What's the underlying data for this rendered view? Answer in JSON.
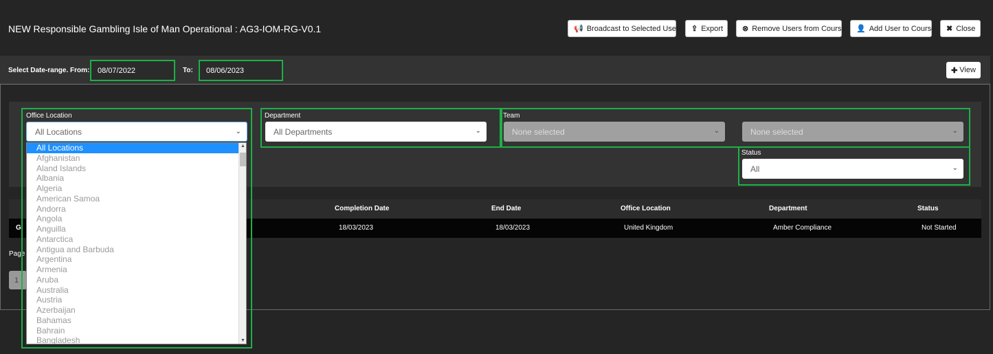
{
  "header": {
    "title": "NEW Responsible Gambling Isle of Man Operational : AG3-IOM-RG-V0.1",
    "buttons": {
      "broadcast": "Broadcast to Selected Users",
      "export": "Export",
      "remove": "Remove Users from Course",
      "add": "Add User to Course",
      "close": "Close"
    }
  },
  "daterange": {
    "from_label": "Select Date-range. From:",
    "from_value": "08/07/2022",
    "to_label": "To:",
    "to_value": "08/06/2023",
    "view_label": "View"
  },
  "filters": {
    "office_label": "Office Location",
    "office_value": "All Locations",
    "department_label": "Department",
    "department_value": "All Departments",
    "team_label": "Team",
    "team_value": "None selected",
    "team2_value": "None selected",
    "status_label": "Status",
    "status_value": "All"
  },
  "table": {
    "headers": [
      "Completion Date",
      "End Date",
      "Office Location",
      "Department",
      "Status"
    ],
    "row": {
      "first": "G",
      "completion_date": "18/03/2023",
      "end_date": "18/03/2023",
      "office": "United Kingdom",
      "department": "Amber Compliance",
      "status": "Not Started"
    }
  },
  "pager": {
    "label": "Page",
    "current": "1"
  },
  "dropdown_options": [
    "All Locations",
    "Afghanistan",
    "Aland Islands",
    "Albania",
    "Algeria",
    "American Samoa",
    "Andorra",
    "Angola",
    "Anguilla",
    "Antarctica",
    "Antigua and Barbuda",
    "Argentina",
    "Armenia",
    "Aruba",
    "Australia",
    "Austria",
    "Azerbaijan",
    "Bahamas",
    "Bahrain",
    "Bangladesh"
  ],
  "colors": {
    "highlight": "#1db146",
    "selected": "#1e90ff"
  }
}
